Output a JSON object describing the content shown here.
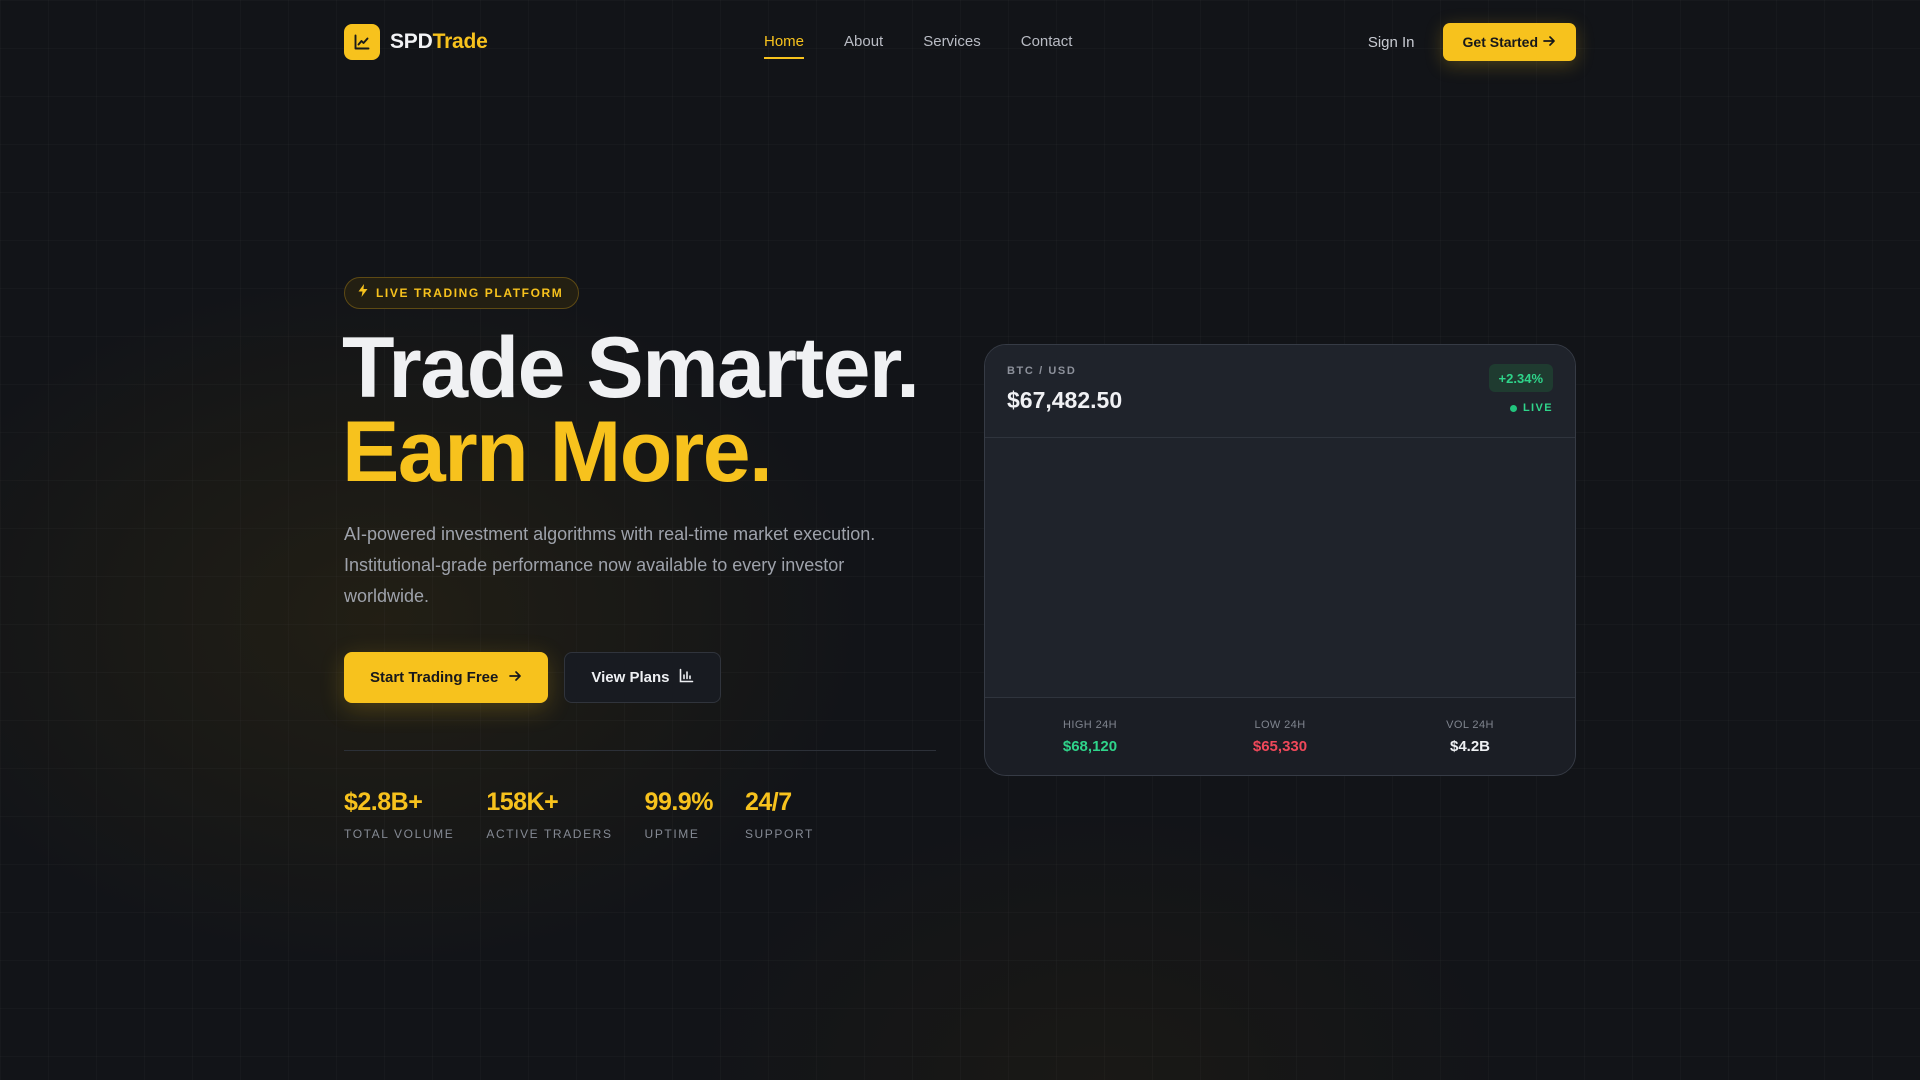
{
  "colors": {
    "accent": "#f7c21d",
    "up": "#2fd48a",
    "down": "#f0485a",
    "background": "#121418"
  },
  "brand": {
    "part1": "SPD",
    "part2": "Trade",
    "icon": "chart-line-icon"
  },
  "nav": {
    "links": [
      {
        "label": "Home",
        "active": true
      },
      {
        "label": "About",
        "active": false
      },
      {
        "label": "Services",
        "active": false
      },
      {
        "label": "Contact",
        "active": false
      }
    ],
    "sign_in": "Sign In",
    "get_started": "Get Started"
  },
  "hero": {
    "badge": "LIVE TRADING PLATFORM",
    "headline_line1": "Trade Smarter.",
    "headline_line2": "Earn More.",
    "subtitle": "AI-powered investment algorithms with real-time market execution. Institutional-grade performance now available to every investor worldwide.",
    "cta_primary": "Start Trading Free",
    "cta_secondary": "View Plans"
  },
  "stats": [
    {
      "value": "$2.8B+",
      "label": "TOTAL VOLUME"
    },
    {
      "value": "158K+",
      "label": "ACTIVE TRADERS"
    },
    {
      "value": "99.9%",
      "label": "UPTIME"
    },
    {
      "value": "24/7",
      "label": "SUPPORT"
    }
  ],
  "ticker": {
    "pair": "BTC / USD",
    "price": "$67,482.50",
    "change": "+2.34%",
    "status": "LIVE",
    "high_label": "HIGH 24H",
    "high_value": "$68,120",
    "low_label": "LOW 24H",
    "low_value": "$65,330",
    "vol_label": "VOL 24H",
    "vol_value": "$4.2B"
  }
}
